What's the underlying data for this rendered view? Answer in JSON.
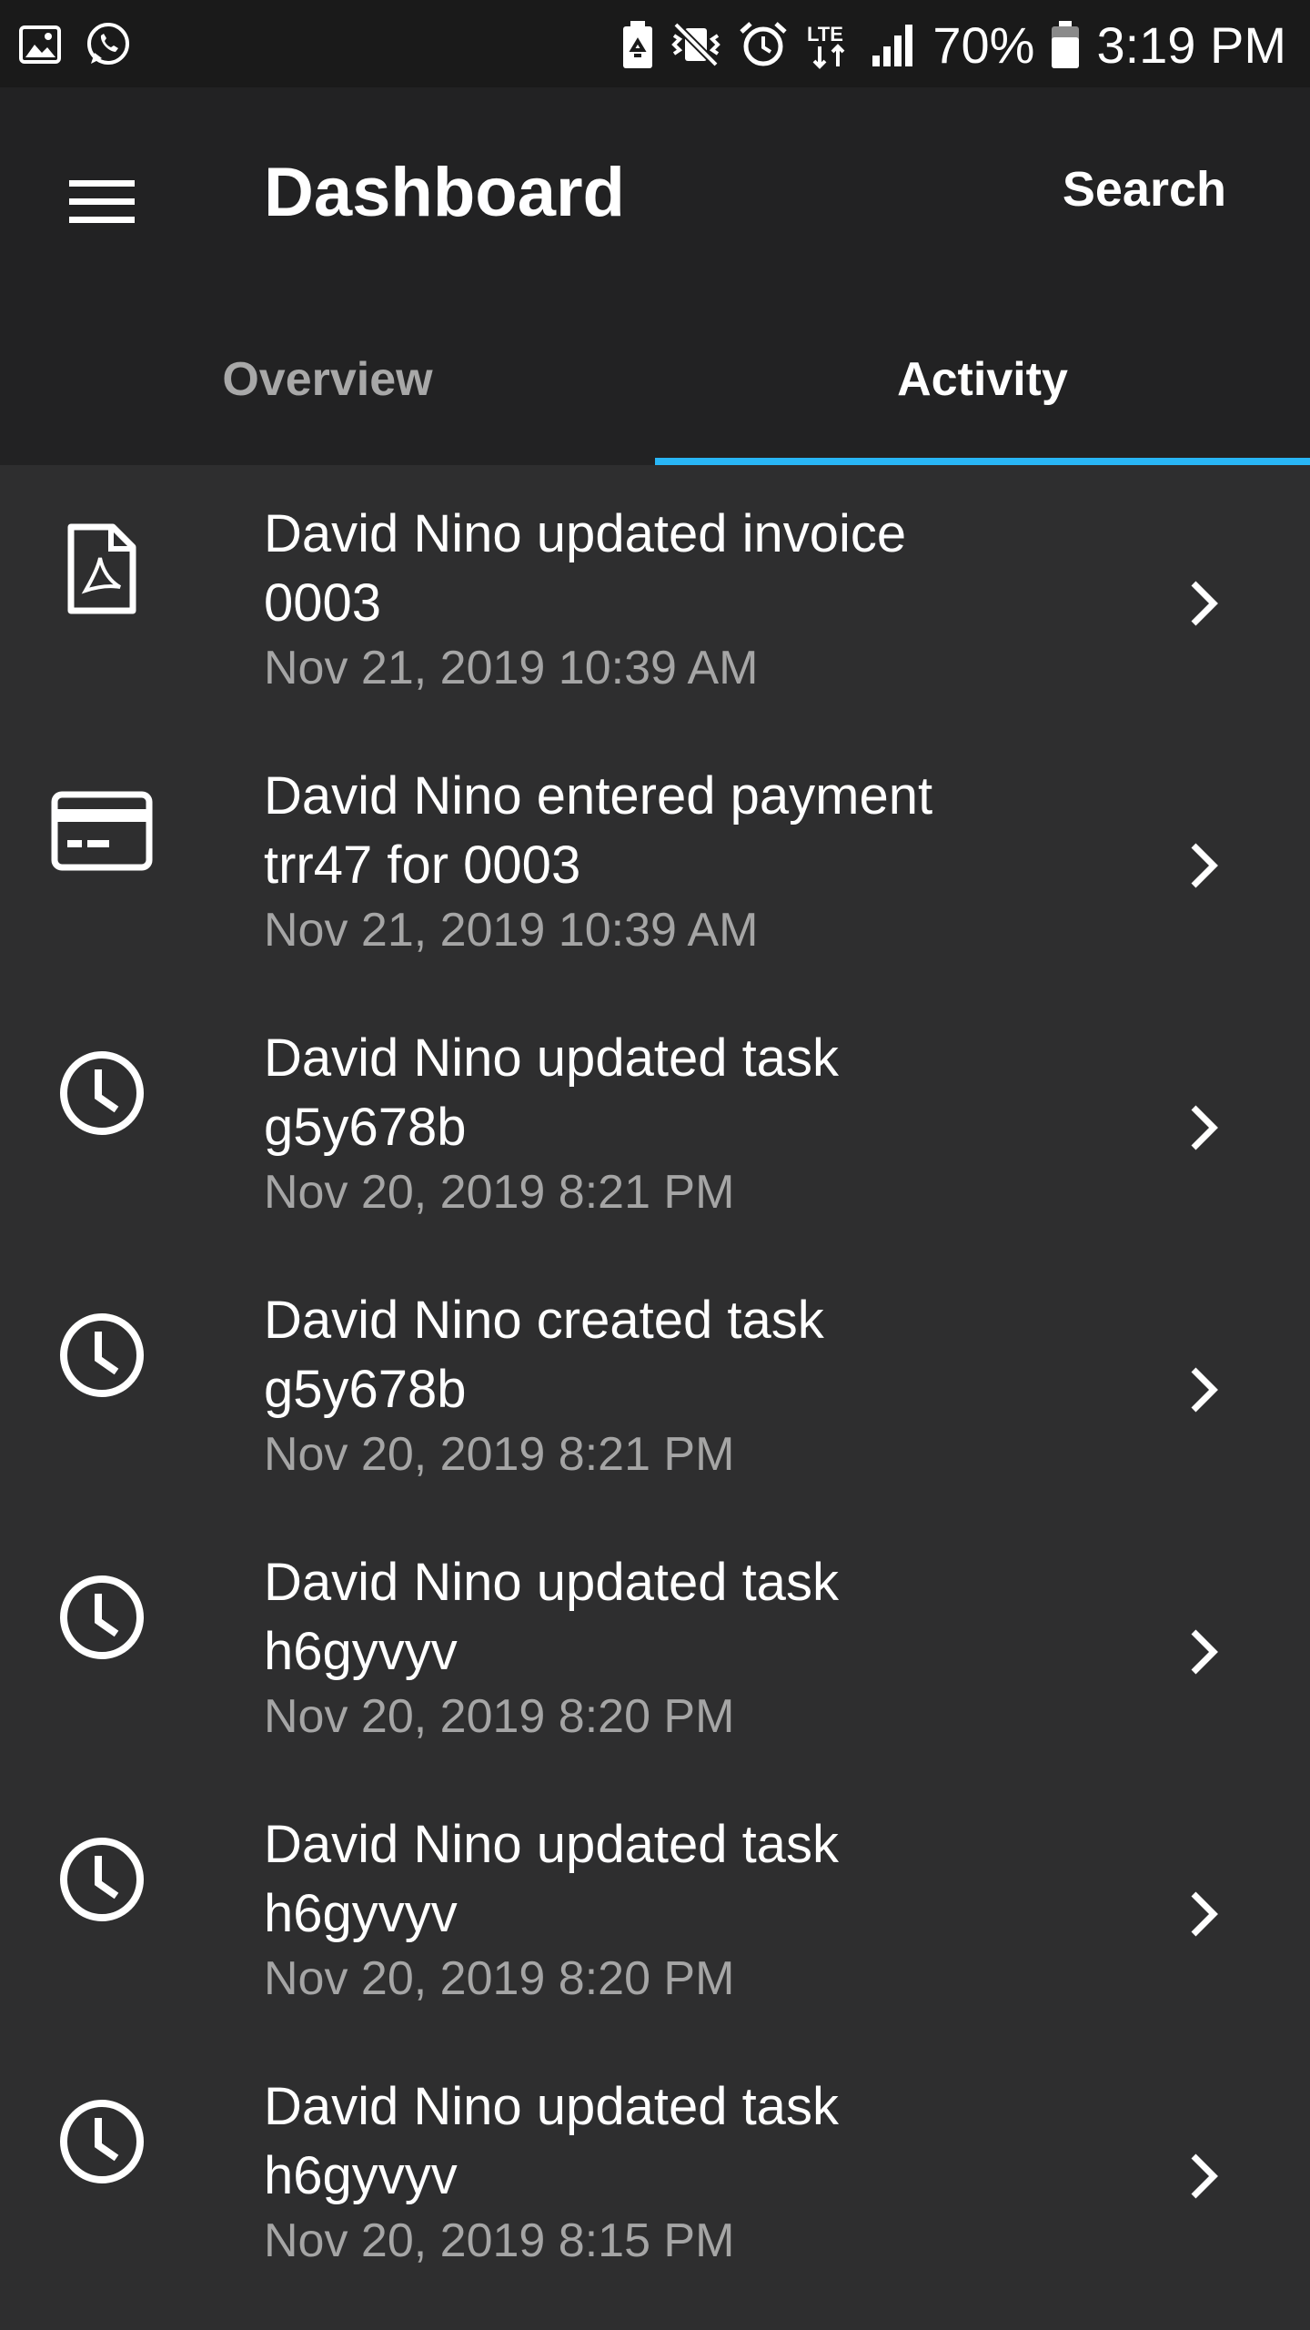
{
  "status_bar": {
    "battery_percent": "70%",
    "time": "3:19 PM",
    "network": "LTE",
    "left_icons": [
      "image-icon",
      "whatsapp-icon"
    ],
    "right_icons": [
      "battery-saver-icon",
      "vibrate-mute-icon",
      "alarm-icon",
      "lte-icon",
      "signal-icon",
      "battery-icon"
    ]
  },
  "app_bar": {
    "title": "Dashboard",
    "search_label": "Search"
  },
  "tabs": [
    {
      "label": "Overview",
      "active": false
    },
    {
      "label": "Activity",
      "active": true
    }
  ],
  "colors": {
    "accent": "#29b6f6",
    "background": "#2e2e2f",
    "app_bar": "#222223",
    "status_bar": "#1a1a1a",
    "secondary_text": "#a5a5a5"
  },
  "activity": [
    {
      "icon": "pdf-document-icon",
      "title": "David Nino updated invoice\n0003",
      "date": "Nov 21, 2019 10:39 AM"
    },
    {
      "icon": "credit-card-icon",
      "title": "David Nino entered payment\ntrr47 for 0003",
      "date": "Nov 21, 2019 10:39 AM"
    },
    {
      "icon": "clock-icon",
      "title": "David Nino updated task\ng5y678b",
      "date": "Nov 20, 2019 8:21 PM"
    },
    {
      "icon": "clock-icon",
      "title": "David Nino created task\ng5y678b",
      "date": "Nov 20, 2019 8:21 PM"
    },
    {
      "icon": "clock-icon",
      "title": "David Nino updated task\nh6gyvyv",
      "date": "Nov 20, 2019 8:20 PM"
    },
    {
      "icon": "clock-icon",
      "title": "David Nino updated task\nh6gyvyv",
      "date": "Nov 20, 2019 8:20 PM"
    },
    {
      "icon": "clock-icon",
      "title": "David Nino updated task\nh6gyvyv",
      "date": "Nov 20, 2019 8:15 PM"
    }
  ]
}
